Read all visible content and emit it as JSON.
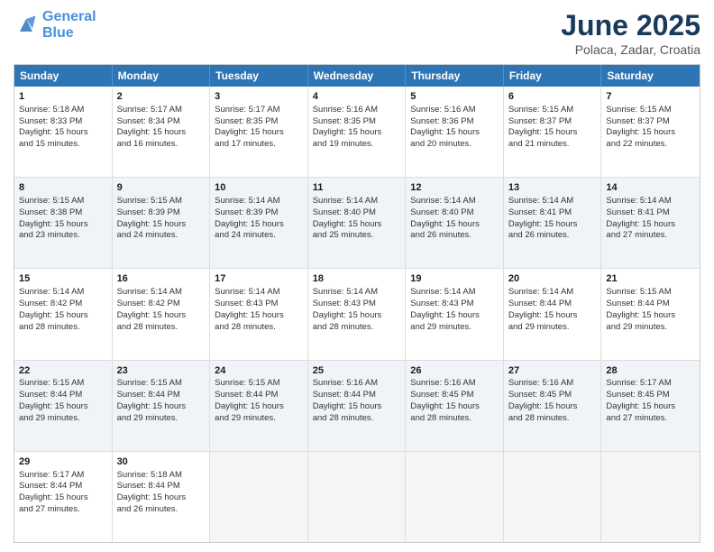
{
  "header": {
    "logo_line1": "General",
    "logo_line2": "Blue",
    "title": "June 2025",
    "subtitle": "Polaca, Zadar, Croatia"
  },
  "calendar": {
    "weekdays": [
      "Sunday",
      "Monday",
      "Tuesday",
      "Wednesday",
      "Thursday",
      "Friday",
      "Saturday"
    ],
    "rows": [
      [
        {
          "day": "1",
          "lines": [
            "Sunrise: 5:18 AM",
            "Sunset: 8:33 PM",
            "Daylight: 15 hours",
            "and 15 minutes."
          ]
        },
        {
          "day": "2",
          "lines": [
            "Sunrise: 5:17 AM",
            "Sunset: 8:34 PM",
            "Daylight: 15 hours",
            "and 16 minutes."
          ]
        },
        {
          "day": "3",
          "lines": [
            "Sunrise: 5:17 AM",
            "Sunset: 8:35 PM",
            "Daylight: 15 hours",
            "and 17 minutes."
          ]
        },
        {
          "day": "4",
          "lines": [
            "Sunrise: 5:16 AM",
            "Sunset: 8:35 PM",
            "Daylight: 15 hours",
            "and 19 minutes."
          ]
        },
        {
          "day": "5",
          "lines": [
            "Sunrise: 5:16 AM",
            "Sunset: 8:36 PM",
            "Daylight: 15 hours",
            "and 20 minutes."
          ]
        },
        {
          "day": "6",
          "lines": [
            "Sunrise: 5:15 AM",
            "Sunset: 8:37 PM",
            "Daylight: 15 hours",
            "and 21 minutes."
          ]
        },
        {
          "day": "7",
          "lines": [
            "Sunrise: 5:15 AM",
            "Sunset: 8:37 PM",
            "Daylight: 15 hours",
            "and 22 minutes."
          ]
        }
      ],
      [
        {
          "day": "8",
          "lines": [
            "Sunrise: 5:15 AM",
            "Sunset: 8:38 PM",
            "Daylight: 15 hours",
            "and 23 minutes."
          ]
        },
        {
          "day": "9",
          "lines": [
            "Sunrise: 5:15 AM",
            "Sunset: 8:39 PM",
            "Daylight: 15 hours",
            "and 24 minutes."
          ]
        },
        {
          "day": "10",
          "lines": [
            "Sunrise: 5:14 AM",
            "Sunset: 8:39 PM",
            "Daylight: 15 hours",
            "and 24 minutes."
          ]
        },
        {
          "day": "11",
          "lines": [
            "Sunrise: 5:14 AM",
            "Sunset: 8:40 PM",
            "Daylight: 15 hours",
            "and 25 minutes."
          ]
        },
        {
          "day": "12",
          "lines": [
            "Sunrise: 5:14 AM",
            "Sunset: 8:40 PM",
            "Daylight: 15 hours",
            "and 26 minutes."
          ]
        },
        {
          "day": "13",
          "lines": [
            "Sunrise: 5:14 AM",
            "Sunset: 8:41 PM",
            "Daylight: 15 hours",
            "and 26 minutes."
          ]
        },
        {
          "day": "14",
          "lines": [
            "Sunrise: 5:14 AM",
            "Sunset: 8:41 PM",
            "Daylight: 15 hours",
            "and 27 minutes."
          ]
        }
      ],
      [
        {
          "day": "15",
          "lines": [
            "Sunrise: 5:14 AM",
            "Sunset: 8:42 PM",
            "Daylight: 15 hours",
            "and 28 minutes."
          ]
        },
        {
          "day": "16",
          "lines": [
            "Sunrise: 5:14 AM",
            "Sunset: 8:42 PM",
            "Daylight: 15 hours",
            "and 28 minutes."
          ]
        },
        {
          "day": "17",
          "lines": [
            "Sunrise: 5:14 AM",
            "Sunset: 8:43 PM",
            "Daylight: 15 hours",
            "and 28 minutes."
          ]
        },
        {
          "day": "18",
          "lines": [
            "Sunrise: 5:14 AM",
            "Sunset: 8:43 PM",
            "Daylight: 15 hours",
            "and 28 minutes."
          ]
        },
        {
          "day": "19",
          "lines": [
            "Sunrise: 5:14 AM",
            "Sunset: 8:43 PM",
            "Daylight: 15 hours",
            "and 29 minutes."
          ]
        },
        {
          "day": "20",
          "lines": [
            "Sunrise: 5:14 AM",
            "Sunset: 8:44 PM",
            "Daylight: 15 hours",
            "and 29 minutes."
          ]
        },
        {
          "day": "21",
          "lines": [
            "Sunrise: 5:15 AM",
            "Sunset: 8:44 PM",
            "Daylight: 15 hours",
            "and 29 minutes."
          ]
        }
      ],
      [
        {
          "day": "22",
          "lines": [
            "Sunrise: 5:15 AM",
            "Sunset: 8:44 PM",
            "Daylight: 15 hours",
            "and 29 minutes."
          ]
        },
        {
          "day": "23",
          "lines": [
            "Sunrise: 5:15 AM",
            "Sunset: 8:44 PM",
            "Daylight: 15 hours",
            "and 29 minutes."
          ]
        },
        {
          "day": "24",
          "lines": [
            "Sunrise: 5:15 AM",
            "Sunset: 8:44 PM",
            "Daylight: 15 hours",
            "and 29 minutes."
          ]
        },
        {
          "day": "25",
          "lines": [
            "Sunrise: 5:16 AM",
            "Sunset: 8:44 PM",
            "Daylight: 15 hours",
            "and 28 minutes."
          ]
        },
        {
          "day": "26",
          "lines": [
            "Sunrise: 5:16 AM",
            "Sunset: 8:45 PM",
            "Daylight: 15 hours",
            "and 28 minutes."
          ]
        },
        {
          "day": "27",
          "lines": [
            "Sunrise: 5:16 AM",
            "Sunset: 8:45 PM",
            "Daylight: 15 hours",
            "and 28 minutes."
          ]
        },
        {
          "day": "28",
          "lines": [
            "Sunrise: 5:17 AM",
            "Sunset: 8:45 PM",
            "Daylight: 15 hours",
            "and 27 minutes."
          ]
        }
      ],
      [
        {
          "day": "29",
          "lines": [
            "Sunrise: 5:17 AM",
            "Sunset: 8:44 PM",
            "Daylight: 15 hours",
            "and 27 minutes."
          ]
        },
        {
          "day": "30",
          "lines": [
            "Sunrise: 5:18 AM",
            "Sunset: 8:44 PM",
            "Daylight: 15 hours",
            "and 26 minutes."
          ]
        },
        {
          "day": "",
          "lines": []
        },
        {
          "day": "",
          "lines": []
        },
        {
          "day": "",
          "lines": []
        },
        {
          "day": "",
          "lines": []
        },
        {
          "day": "",
          "lines": []
        }
      ]
    ],
    "row_shaded": [
      false,
      true,
      false,
      true,
      false
    ]
  }
}
